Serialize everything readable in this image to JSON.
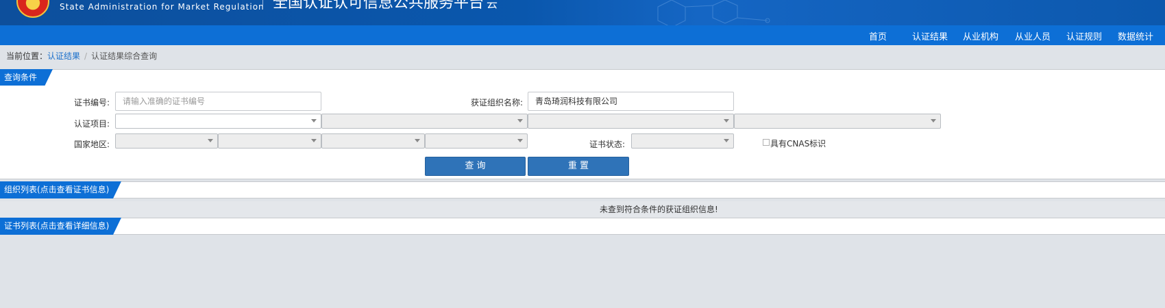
{
  "header": {
    "agency_en": "State Administration  for  Market Regulation",
    "platform_title": "全国认证认可信息公共服务平台",
    "platform_mark": "云"
  },
  "nav": {
    "items": [
      "首页",
      "认证结果",
      "从业机构",
      "从业人员",
      "认证规则",
      "数据统计"
    ]
  },
  "breadcrumb": {
    "prefix": "当前位置：",
    "link": "认证结果",
    "separator": "/",
    "current": "认证结果综合查询"
  },
  "query": {
    "section_title": "查询条件",
    "cert_no_label": "证书编号:",
    "cert_no_placeholder": "请输入准确的证书编号",
    "org_name_label": "获证组织名称:",
    "org_name_value": "青岛琦润科技有限公司",
    "project_label": "认证项目:",
    "region_label": "国家地区:",
    "status_label": "证书状态:",
    "cnas_label": "具有CNAS标识",
    "search_button": "查 询",
    "reset_button": "重 置"
  },
  "org_list": {
    "title": "组织列表(点击查看证书信息)",
    "empty_message": "未查到符合条件的获证组织信息!"
  },
  "cert_list": {
    "title": "证书列表(点击查看详细信息)"
  }
}
